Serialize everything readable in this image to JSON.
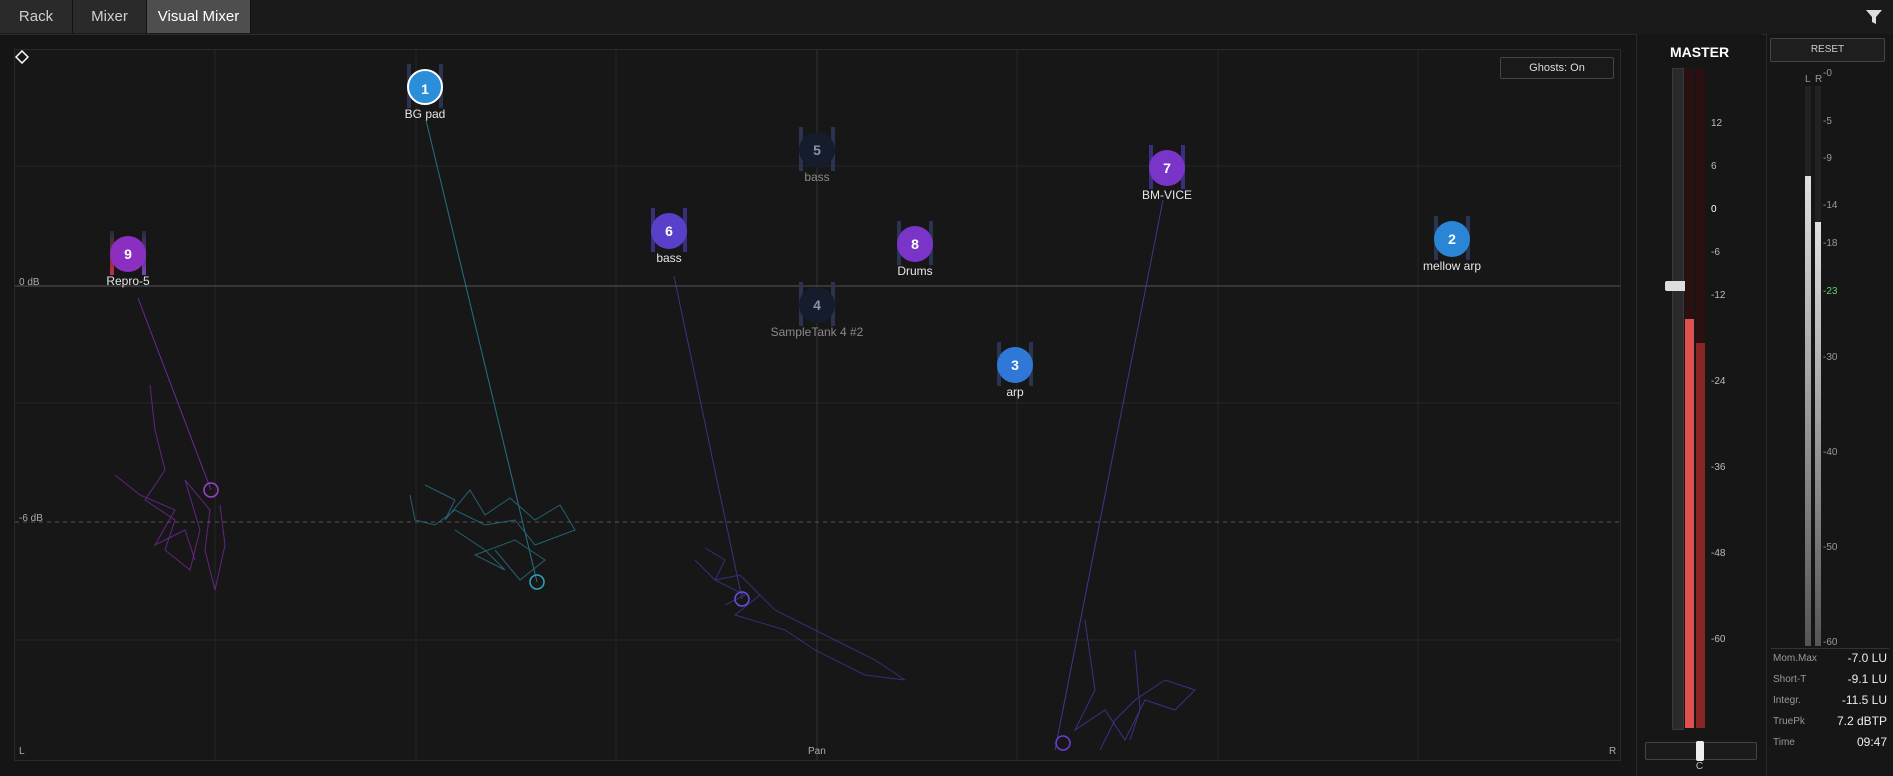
{
  "tabs": [
    {
      "label": "Rack",
      "active": false
    },
    {
      "label": "Mixer",
      "active": false
    },
    {
      "label": "Visual Mixer",
      "active": true
    }
  ],
  "filter_icon": "filter-icon",
  "stage": {
    "ghosts_label": "Ghosts: On",
    "zero_db_label": "0 dB",
    "minus6_label": "-6 dB",
    "left_label": "L",
    "pan_label": "Pan",
    "right_label": "R"
  },
  "channels": [
    {
      "num": "1",
      "name": "BG pad",
      "color": "#2a8fd8",
      "selected": true,
      "dim": false
    },
    {
      "num": "2",
      "name": "mellow arp",
      "color": "#2a86d4",
      "selected": false,
      "dim": false
    },
    {
      "num": "3",
      "name": "arp",
      "color": "#2f78d6",
      "selected": false,
      "dim": false
    },
    {
      "num": "4",
      "name": "SampleTank 4 #2",
      "color": "#151c2c",
      "selected": false,
      "dim": true
    },
    {
      "num": "5",
      "name": "bass",
      "color": "#151c2c",
      "selected": false,
      "dim": true
    },
    {
      "num": "6",
      "name": "bass",
      "color": "#5a3fc8",
      "selected": false,
      "dim": false
    },
    {
      "num": "7",
      "name": "BM-VICE",
      "color": "#7a35c8",
      "selected": false,
      "dim": false
    },
    {
      "num": "8",
      "name": "Drums",
      "color": "#7a35c8",
      "selected": false,
      "dim": false
    },
    {
      "num": "9",
      "name": "Repro-5",
      "color": "#8a2fc0",
      "selected": false,
      "dim": false
    }
  ],
  "master": {
    "title": "MASTER",
    "scale": [
      "12",
      "6",
      "0",
      "-6",
      "-12",
      "-24",
      "-36",
      "-48",
      "-60"
    ],
    "pan_label": "C",
    "meter_level": 0.62
  },
  "loudness": {
    "reset_label": "RESET",
    "channels": [
      "L",
      "R"
    ],
    "scale": [
      "-0",
      "-5",
      "-9",
      "-14",
      "-18",
      "-23",
      "-30",
      "-40",
      "-50",
      "-60"
    ],
    "readouts": [
      {
        "label": "Mom.Max",
        "value": "-7.0 LU"
      },
      {
        "label": "Short-T",
        "value": "-9.1 LU"
      },
      {
        "label": "Integr.",
        "value": "-11.5 LU"
      },
      {
        "label": "TruePk",
        "value": "7.2 dBTP"
      },
      {
        "label": "Time",
        "value": "09:47"
      }
    ]
  }
}
